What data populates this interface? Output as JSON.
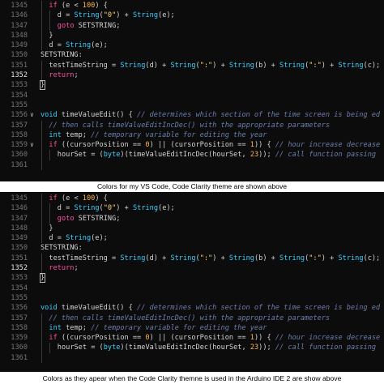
{
  "panel1": {
    "lines": [
      {
        "n": "1345",
        "indent": 1,
        "html": "<span class='kw'>if</span> (e &lt; <span class='num'>100</span>) {"
      },
      {
        "n": "1346",
        "indent": 2,
        "html": "d = <span class='ty'>String</span>(<span class='str'>\"0\"</span>) + <span class='ty'>String</span>(e);"
      },
      {
        "n": "1347",
        "indent": 2,
        "html": "<span class='kw'>goto</span> SETSTRING;"
      },
      {
        "n": "1348",
        "indent": 1,
        "html": "}"
      },
      {
        "n": "1349",
        "indent": 1,
        "html": "d = <span class='ty'>String</span>(e);"
      },
      {
        "n": "1350",
        "indent": 0,
        "html": "SETSTRING:"
      },
      {
        "n": "1351",
        "indent": 1,
        "html": "testTimeString = <span class='ty'>String</span>(d) + <span class='ty'>String</span>(<span class='str'>\":\"</span>) + <span class='ty'>String</span>(b) + <span class='ty'>String</span>(<span class='str'>\":\"</span>) + <span class='ty'>String</span>(c);"
      },
      {
        "n": "1352",
        "indent": 1,
        "active": true,
        "html": "<span class='kw'>return</span>;"
      },
      {
        "n": "1353",
        "indent": 0,
        "html": "<span class='bracket-box'>}</span>"
      },
      {
        "n": "1354",
        "indent": 0,
        "html": ""
      },
      {
        "n": "1355",
        "indent": 0,
        "html": ""
      },
      {
        "n": "1356",
        "indent": 0,
        "fold": true,
        "html": "<span class='ty'>void</span> timeValueEdit() { <span class='com'>// determines which section of the time screen is being ed</span>"
      },
      {
        "n": "1357",
        "indent": 1,
        "html": "<span class='com'>// then calls timeValueEditIncDec() with the appropriate parameters</span>"
      },
      {
        "n": "1358",
        "indent": 1,
        "html": "<span class='ty'>int</span> temp; <span class='com'>// temporary variable for editing the year</span>"
      },
      {
        "n": "1359",
        "indent": 1,
        "fold": true,
        "html": "<span class='kw'>if</span> ((cursorPosition == <span class='num'>0</span>) || (cursorPosition == <span class='num'>1</span>)) { <span class='com'>// hour increase decrease</span>"
      },
      {
        "n": "1360",
        "indent": 2,
        "html": "hourSet = (<span class='ty'>byte</span>)(timeValueEditIncDec(hourSet, <span class='num'>23</span>)); <span class='com'>// call function passing</span>"
      },
      {
        "n": "1361",
        "indent": 1,
        "html": ""
      }
    ]
  },
  "caption1": "Colors for my VS Code, Code Clarity theme are shown above",
  "panel2": {
    "lines": [
      {
        "n": "1345",
        "indent": 1,
        "html": "<span class='kw'>if</span> (e &lt; <span class='num'>100</span>) {"
      },
      {
        "n": "1346",
        "indent": 2,
        "html": "d = <span class='ty'>String</span>(<span class='str'>\"0\"</span>) + <span class='ty'>String</span>(e);"
      },
      {
        "n": "1347",
        "indent": 2,
        "html": "<span class='kw'>goto</span> SETSTRING;"
      },
      {
        "n": "1348",
        "indent": 1,
        "html": "}"
      },
      {
        "n": "1349",
        "indent": 1,
        "html": "d = <span class='ty'>String</span>(e);"
      },
      {
        "n": "1350",
        "indent": 0,
        "html": "SETSTRING:"
      },
      {
        "n": "1351",
        "indent": 1,
        "html": "testTimeString = <span class='ty'>String</span>(d) + <span class='ty'>String</span>(<span class='str'>\":\"</span>) + <span class='ty'>String</span>(b) + <span class='ty'>String</span>(<span class='str'>\":\"</span>) + <span class='ty'>String</span>(c);"
      },
      {
        "n": "1352",
        "indent": 1,
        "active": true,
        "html": "<span class='kw'>return</span>;"
      },
      {
        "n": "1353",
        "indent": 0,
        "html": "<span class='bracket-box'>}</span>"
      },
      {
        "n": "1354",
        "indent": 0,
        "html": ""
      },
      {
        "n": "1355",
        "indent": 0,
        "html": ""
      },
      {
        "n": "1356",
        "indent": 0,
        "html": "<span class='ty'>void</span> timeValueEdit() { <span class='com'>// determines which section of the time screen is being ed</span>"
      },
      {
        "n": "1357",
        "indent": 1,
        "html": "<span class='com'>// then calls timeValueEditIncDec() with the appropriate parameters</span>"
      },
      {
        "n": "1358",
        "indent": 1,
        "html": "<span class='ty'>int</span> temp; <span class='com'>// temporary variable for editing the year</span>"
      },
      {
        "n": "1359",
        "indent": 1,
        "html": "<span class='kw'>if</span> ((cursorPosition == <span class='num'>0</span>) || (cursorPosition == <span class='num'>1</span>)) { <span class='com'>// hour increase decrease</span>"
      },
      {
        "n": "1360",
        "indent": 2,
        "html": "hourSet = (<span class='ty'>byte</span>)(timeValueEditIncDec(hourSet, <span class='num'>23</span>)); <span class='com'>// call function passing</span>"
      },
      {
        "n": "1361",
        "indent": 1,
        "html": ""
      }
    ]
  },
  "caption2": "Colors as they apear when the Code Clarity themne is used in the Arduino IDE 2 are show above"
}
